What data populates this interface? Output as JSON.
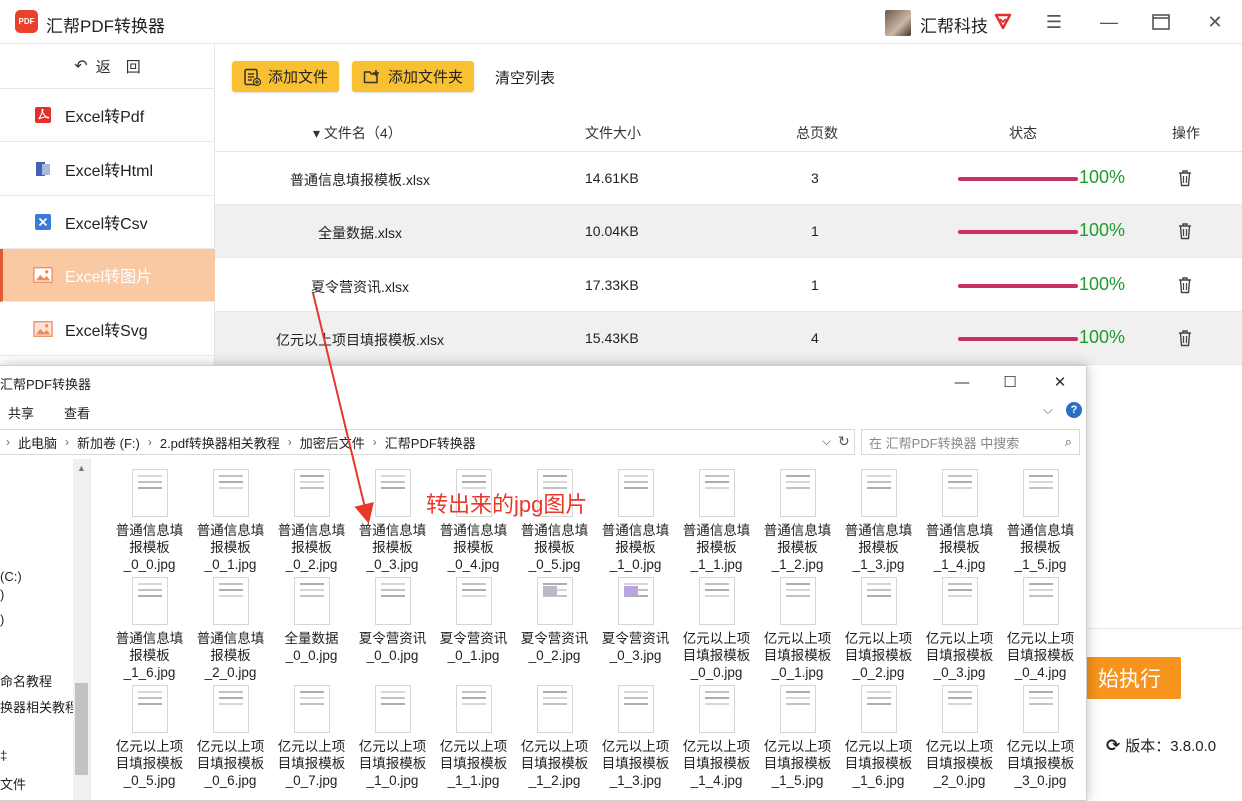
{
  "app": {
    "logo_text": "PDF",
    "title": "汇帮PDF转换器",
    "company": "汇帮科技",
    "window_controls": [
      "menu-icon",
      "minimize-icon",
      "maximize-icon",
      "close-icon"
    ]
  },
  "sidebar": {
    "back_label": "返　回",
    "items": [
      {
        "label": "Excel转Pdf",
        "icon": "pdf-icon",
        "active": false
      },
      {
        "label": "Excel转Html",
        "icon": "html-icon",
        "active": false
      },
      {
        "label": "Excel转Csv",
        "icon": "csv-icon",
        "active": false
      },
      {
        "label": "Excel转图片",
        "icon": "image-icon",
        "active": true
      },
      {
        "label": "Excel转Svg",
        "icon": "image-icon",
        "active": false
      }
    ]
  },
  "toolbar": {
    "add_file": "添加文件",
    "add_folder": "添加文件夹",
    "clear_list": "清空列表"
  },
  "table": {
    "headers": {
      "name": "▾ 文件名（4）",
      "size": "文件大小",
      "pages": "总页数",
      "status": "状态",
      "action": "操作"
    },
    "rows": [
      {
        "name": "普通信息填报模板.xlsx",
        "size": "14.61KB",
        "pages": "3",
        "progress": 1.0,
        "status": "100%"
      },
      {
        "name": "全量数据.xlsx",
        "size": "10.04KB",
        "pages": "1",
        "progress": 1.0,
        "status": "100%"
      },
      {
        "name": "夏令营资讯.xlsx",
        "size": "17.33KB",
        "pages": "1",
        "progress": 1.0,
        "status": "100%"
      },
      {
        "name": "亿元以上项目填报模板.xlsx",
        "size": "15.43KB",
        "pages": "4",
        "progress": 1.0,
        "status": "100%"
      }
    ]
  },
  "start_button": "始执行",
  "version": "版本：3.8.0.0",
  "explorer": {
    "title": "汇帮PDF转换器",
    "ribbon": [
      "共享",
      "查看"
    ],
    "breadcrumb": [
      "此电脑",
      "新加卷 (F:)",
      "2.pdf转换器相关教程",
      "加密后文件",
      "汇帮PDF转换器"
    ],
    "search_placeholder": "在 汇帮PDF转换器 中搜索",
    "nav_items": [
      "(C:)",
      ")",
      ")",
      "命名教程",
      "换器相关教程",
      "‡",
      "文件"
    ],
    "files": [
      [
        "普通信息填",
        "报模板",
        "_0_0.jpg"
      ],
      [
        "普通信息填",
        "报模板",
        "_0_1.jpg"
      ],
      [
        "普通信息填",
        "报模板",
        "_0_2.jpg"
      ],
      [
        "普通信息填",
        "报模板",
        "_0_3.jpg"
      ],
      [
        "普通信息填",
        "报模板",
        "_0_4.jpg"
      ],
      [
        "普通信息填",
        "报模板",
        "_0_5.jpg"
      ],
      [
        "普通信息填",
        "报模板",
        "_1_0.jpg"
      ],
      [
        "普通信息填",
        "报模板",
        "_1_1.jpg"
      ],
      [
        "普通信息填",
        "报模板",
        "_1_2.jpg"
      ],
      [
        "普通信息填",
        "报模板",
        "_1_3.jpg"
      ],
      [
        "普通信息填",
        "报模板",
        "_1_4.jpg"
      ],
      [
        "普通信息填",
        "报模板",
        "_1_5.jpg"
      ],
      [
        "普通信息填",
        "报模板",
        "_1_6.jpg"
      ],
      [
        "普通信息填",
        "报模板",
        "_2_0.jpg"
      ],
      [
        "全量数据",
        "_0_0.jpg"
      ],
      [
        "夏令营资讯",
        "_0_0.jpg"
      ],
      [
        "夏令营资讯",
        "_0_1.jpg"
      ],
      [
        "夏令营资讯",
        "_0_2.jpg"
      ],
      [
        "夏令营资讯",
        "_0_3.jpg"
      ],
      [
        "亿元以上项",
        "目填报模板",
        "_0_0.jpg"
      ],
      [
        "亿元以上项",
        "目填报模板",
        "_0_1.jpg"
      ],
      [
        "亿元以上项",
        "目填报模板",
        "_0_2.jpg"
      ],
      [
        "亿元以上项",
        "目填报模板",
        "_0_3.jpg"
      ],
      [
        "亿元以上项",
        "目填报模板",
        "_0_4.jpg"
      ],
      [
        "亿元以上项",
        "目填报模板",
        "_0_5.jpg"
      ],
      [
        "亿元以上项",
        "目填报模板",
        "_0_6.jpg"
      ],
      [
        "亿元以上项",
        "目填报模板",
        "_0_7.jpg"
      ],
      [
        "亿元以上项",
        "目填报模板",
        "_1_0.jpg"
      ],
      [
        "亿元以上项",
        "目填报模板",
        "_1_1.jpg"
      ],
      [
        "亿元以上项",
        "目填报模板",
        "_1_2.jpg"
      ],
      [
        "亿元以上项",
        "目填报模板",
        "_1_3.jpg"
      ],
      [
        "亿元以上项",
        "目填报模板",
        "_1_4.jpg"
      ],
      [
        "亿元以上项",
        "目填报模板",
        "_1_5.jpg"
      ],
      [
        "亿元以上项",
        "目填报模板",
        "_1_6.jpg"
      ],
      [
        "亿元以上项",
        "目填报模板",
        "_2_0.jpg"
      ],
      [
        "亿元以上项",
        "目填报模板",
        "_3_0.jpg"
      ]
    ]
  },
  "annotation": "转出来的jpg图片",
  "colors": {
    "accent_orange": "#f7941d",
    "button_yellow": "#f9c132",
    "active_item": "#f9c9a4",
    "progress_bar": "#c7305f",
    "progress_text": "#1f9c2c",
    "annotation_red": "#e8382a"
  }
}
